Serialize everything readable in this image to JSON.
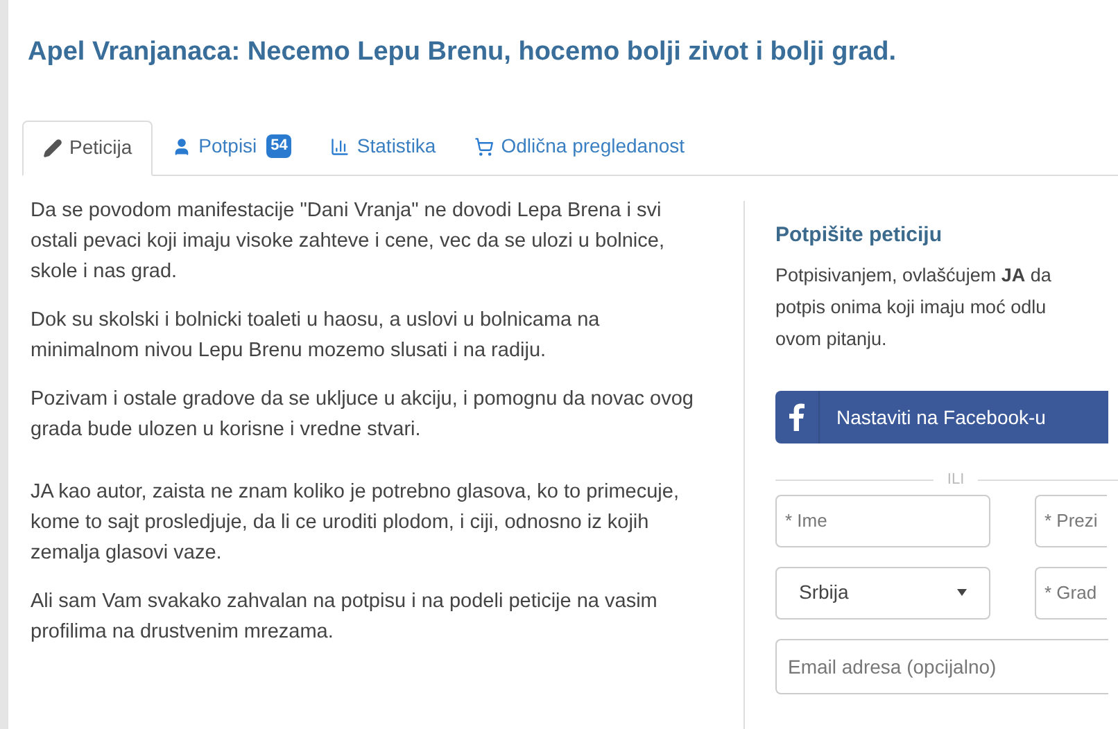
{
  "title": "Apel Vranjanaca: Necemo Lepu Brenu, hocemo bolji zivot i bolji grad.",
  "tabs": [
    {
      "label": "Peticija",
      "selected": true
    },
    {
      "label": "Potpisi",
      "badge": "54",
      "selected": false
    },
    {
      "label": "Statistika",
      "selected": false
    },
    {
      "label": "Odlična pregledanost",
      "selected": false
    }
  ],
  "paragraphs": [
    "Da se povodom manifestacije \"Dani Vranja\" ne dovodi Lepa Brena i svi ostali pevaci koji  imaju visoke zahteve i cene, vec da se ulozi u bolnice, skole i nas grad.",
    "Dok su skolski i bolnicki toaleti u haosu, a uslovi u bolnicama na minimalnom nivou Lepu Brenu mozemo slusati i na radiju.",
    "Pozivam i ostale gradove da se ukljuce u akciju, i pomognu da novac ovog grada bude ulozen u korisne i vredne stvari.",
    "JA kao autor, zaista ne znam koliko je potrebno glasova, ko to primecuje, kome to sajt prosledjuje, da li ce uroditi plodom, i ciji, odnosno iz kojih zemalja glasovi vaze.",
    "Ali sam Vam svakako zahvalan na potpisu i na podeli peticije na vasim profilima na drustvenim mrezama."
  ],
  "sign": {
    "heading": "Potpišite peticiju",
    "intro_lines": [
      "Potpisivanjem, ovlašćujem **JA** da",
      "potpis onima koji imaju moć odlu",
      "ovom pitanju."
    ],
    "facebook_button": "Nastaviti na Facebook-u",
    "separator": "ILI",
    "first_name": {
      "placeholder": "* Ime"
    },
    "last_name": {
      "placeholder": "* Prezi"
    },
    "country": {
      "value": "Srbija"
    },
    "city": {
      "placeholder": "* Grad"
    },
    "email": {
      "placeholder": "Email adresa (opcijalno)"
    }
  }
}
